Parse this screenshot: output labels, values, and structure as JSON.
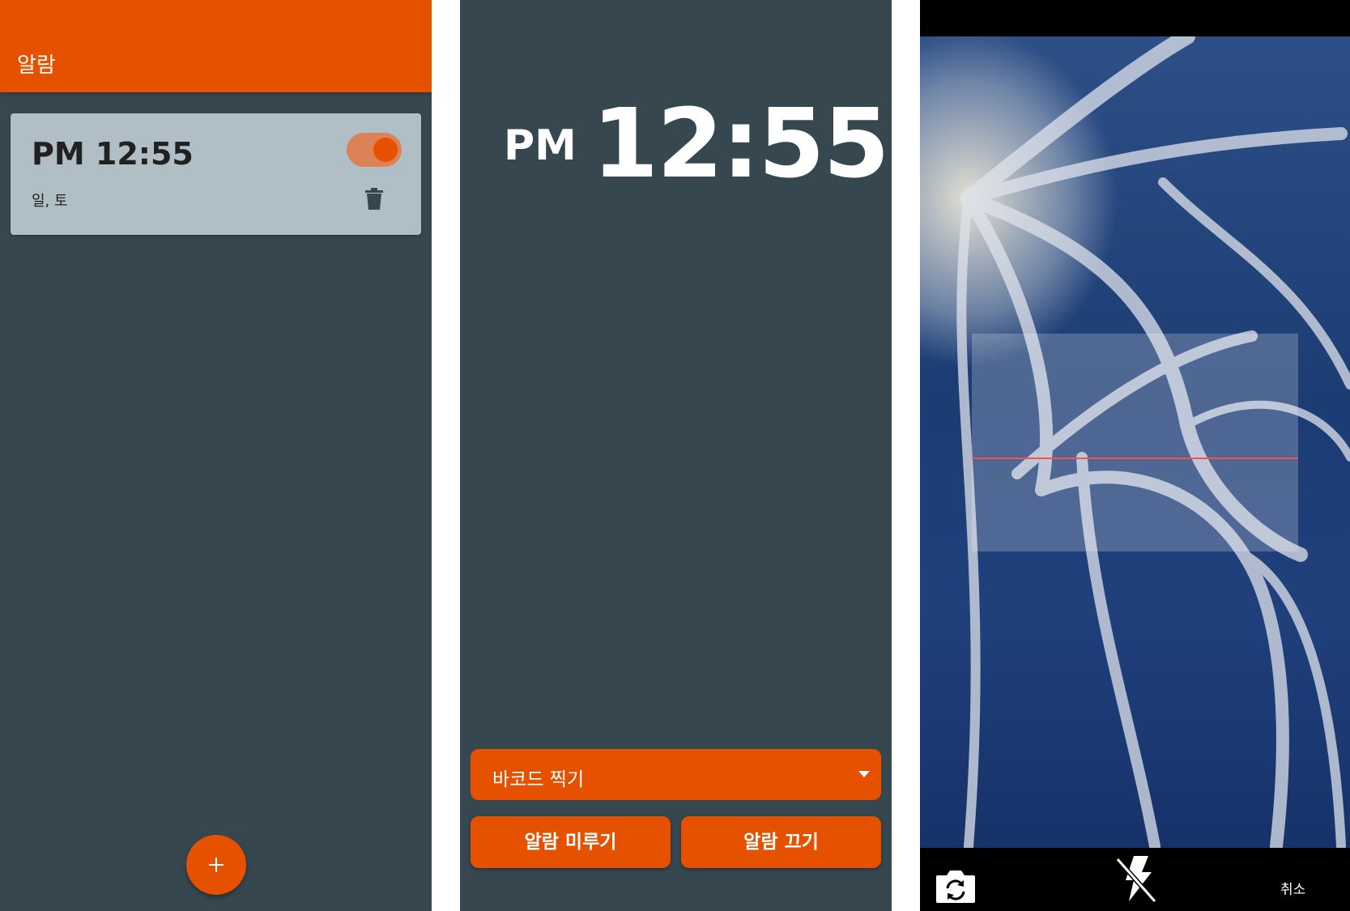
{
  "alarm_list": {
    "appbar_title": "알람",
    "alarms": [
      {
        "time": "PM 12:55",
        "days": "일, 토",
        "enabled": true
      }
    ],
    "fab_label": "+"
  },
  "alarm_ringing": {
    "ampm": "PM",
    "time": "12:55",
    "mission_dropdown": {
      "selected": "바코드 찍기"
    },
    "snooze_button": "알람 미루기",
    "dismiss_button": "알람 끄기"
  },
  "barcode_scanner": {
    "cancel_label": "취소",
    "icons": [
      "camera-switch-icon",
      "flash-off-icon"
    ]
  },
  "colors": {
    "accent": "#e65100",
    "background": "#37474f",
    "card": "#b0bec5",
    "scan_line": "#ff4d4d"
  }
}
